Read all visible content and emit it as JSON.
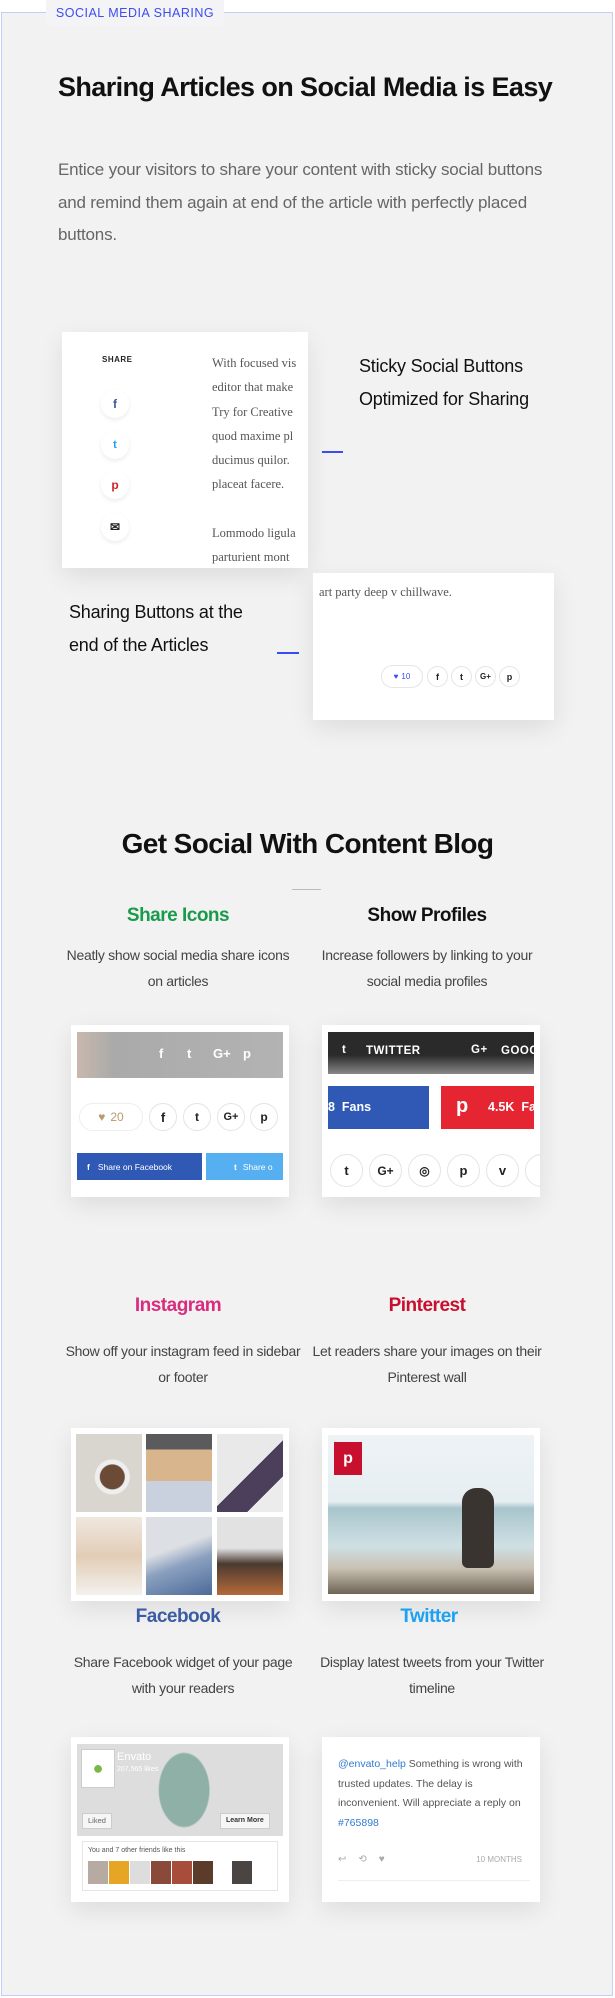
{
  "section_label": "SOCIAL MEDIA SHARING",
  "title": "Sharing Articles on Social Media is Easy",
  "lead": "Entice your visitors to share your content with sticky social buttons and remind them again at end of the article with perfectly placed buttons.",
  "sticky": {
    "share_label": "SHARE",
    "icons": [
      "facebook-icon",
      "twitter-icon",
      "pinterest-icon",
      "email-icon"
    ],
    "article_lines": [
      "With focused vis",
      "editor that make",
      "Try for Creative",
      "quod maxime pl",
      "ducimus quilor.",
      "placeat facere.",
      "",
      "Lommodo ligula",
      "parturient mont"
    ],
    "feature_line1": "Sticky Social Buttons",
    "feature_line2": "Optimized for Sharing"
  },
  "end": {
    "feature_line1": "Sharing Buttons at the",
    "feature_line2": "end of the Articles",
    "article_text": "art party deep v chillwave.",
    "like_count": "10",
    "buttons": [
      "f",
      "t",
      "G+",
      "p"
    ]
  },
  "social": {
    "title": "Get Social With Content Blog",
    "share_icons": {
      "title": "Share Icons",
      "color": "#1a9b4b",
      "desc": "Neatly show social media share icons on articles",
      "like_count": "20",
      "fb_button": "Share on Facebook",
      "tw_button": "Share o"
    },
    "profiles": {
      "title": "Show Profiles",
      "color": "#111111",
      "desc": "Increase followers by linking to your social media profiles",
      "twitter": "TWITTER",
      "google": "GOOG",
      "fans_fb": "8  Fans",
      "fans_pin": "4.5K  Fa"
    },
    "instagram": {
      "title": "Instagram",
      "color": "#d92c7f",
      "desc": "Show off your instagram feed in sidebar or footer"
    },
    "pinterest": {
      "title": "Pinterest",
      "color": "#c8102e",
      "desc": "Let readers share your images on their Pinterest wall"
    },
    "facebook": {
      "title": "Facebook",
      "color": "#3b5ba5",
      "desc": "Share Facebook widget of your page with your readers",
      "page_name": "Envato",
      "likes": "207,565 likes",
      "liked": "Liked",
      "learn_more": "Learn More",
      "friends": "You and 7 other friends like this"
    },
    "twitter": {
      "title": "Twitter",
      "color": "#1da1f2",
      "desc": "Display latest tweets from your Twitter timeline",
      "handle": "@envato_help",
      "tweet": " Something is wrong with trusted updates. The delay is inconvenient. Will appreciate a reply on ",
      "hashtag": "#765898",
      "time": "10 MONTHS"
    }
  }
}
